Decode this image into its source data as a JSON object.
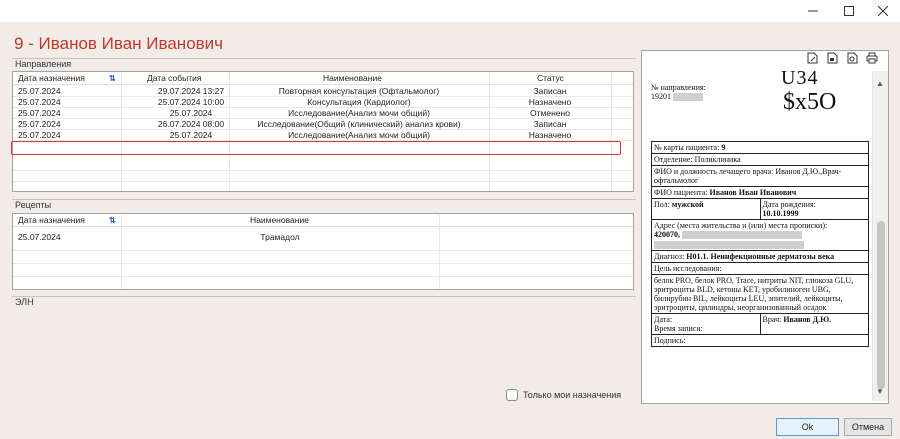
{
  "window": {
    "minimize_icon": "minimize-icon",
    "maximize_icon": "maximize-icon",
    "close_icon": "close-icon"
  },
  "patient_title": "9 - Иванов Иван Иванович",
  "referrals": {
    "section_label": "Направления",
    "columns": [
      "Дата назначения",
      "Дата события",
      "Наименование",
      "Статус"
    ],
    "rows": [
      {
        "date": "25.07.2024",
        "event": "29.07.2024 13:27",
        "name": "Повторная консультация (Офтальмолог)",
        "status": "Записан"
      },
      {
        "date": "25.07.2024",
        "event": "25.07.2024 10:00",
        "name": "Консультация (Кардиолог)",
        "status": "Назначено"
      },
      {
        "date": "25.07.2024",
        "event": "25.07.2024",
        "name": "Исследование(Анализ мочи общий)",
        "status": "Отменено"
      },
      {
        "date": "25.07.2024",
        "event": "26.07.2024 08:00",
        "name": "Исследование(Общий (клинический) анализ крови)",
        "status": "Записан"
      },
      {
        "date": "25.07.2024",
        "event": "25.07.2024",
        "name": "Исследование(Анализ мочи общий)",
        "status": "Назначено"
      }
    ],
    "selected_index": 4
  },
  "prescriptions": {
    "section_label": "Рецепты",
    "columns": [
      "Дата назначения",
      "Наименование"
    ],
    "rows": [
      {
        "date": "25.07.2024",
        "name": "Трамадол"
      }
    ]
  },
  "eln": {
    "section_label": "ЭЛН"
  },
  "only_mine": {
    "label": "Только мои назначения",
    "checked": false
  },
  "preview": {
    "toolbar_icons": [
      "edit-document-icon",
      "export-document-icon",
      "settings-document-icon",
      "print-icon"
    ],
    "referral_label": "№ направления:",
    "referral_number": "19201",
    "barcode_top": "U34",
    "barcode_main": "$x5O",
    "card_label": "№ карты пациента:",
    "card_value": "9",
    "department": "Отделение: Поликлиника",
    "doctor": "ФИО и должность лечащего врача: Иванов Д.Ю.,Врач-офтальмолог",
    "patient_label": "ФИО пациента:",
    "patient_value": "Иванов Иван Иванович",
    "sex_label": "Пол:",
    "sex_value": "мужской",
    "birth_label": "Дата рождения:",
    "birth_value": "10.10.1999",
    "address_label": "Адрес (места жительства и (или) места прописки):",
    "address_value": "420070,",
    "diagnosis_label": "Диагноз:",
    "diagnosis_value": "H01.1. Неинфекционные дерматозы века",
    "purpose": "Цель исследования:",
    "tests": "белок PRO, белок PRO, Trace, нитриты NIT, глюкоза GLU, эритроциты BLD, кетоны KET, уробилиноген UBG, билирубин BIL, лейкоциты LEU, эпителий, лейкоциты, эритроциты, цилиндры, неорганизованный осадок",
    "date_label": "Дата:",
    "time_label": "Время записи:",
    "doctor_label": "Врач:",
    "doctor_value": "Иванов Д.Ю.",
    "signature_label": "Подпись:"
  },
  "buttons": {
    "ok": "Ok",
    "cancel": "Отмена"
  }
}
